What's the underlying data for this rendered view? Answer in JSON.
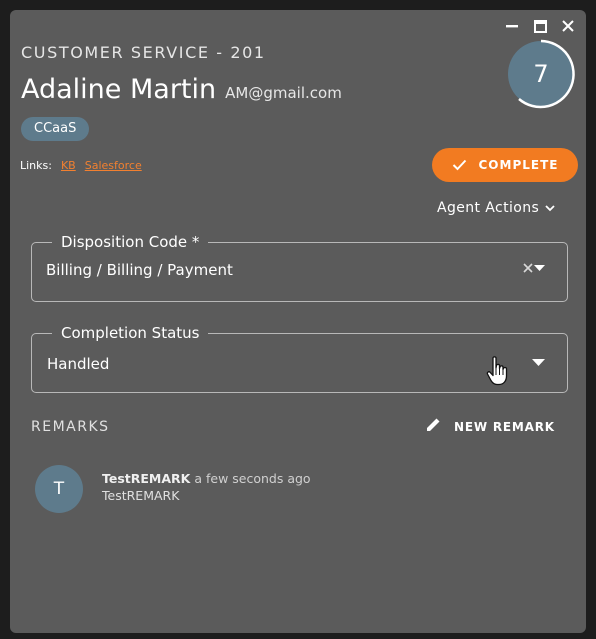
{
  "window": {
    "controls": [
      {
        "name": "minimize-icon"
      },
      {
        "name": "maximize-icon"
      },
      {
        "name": "close-icon"
      }
    ]
  },
  "header": {
    "queue": "CUSTOMER SERVICE - 201",
    "customer_name": "Adaline Martin",
    "customer_email": "AM@gmail.com",
    "chip": "CCaaS",
    "links_label": "Links:",
    "links": [
      "KB",
      "Salesforce"
    ],
    "timer_value": "7"
  },
  "actions": {
    "complete_label": "COMPLETE",
    "agent_actions_label": "Agent Actions"
  },
  "disposition": {
    "label": "Disposition Code *",
    "value": "Billing / Billing / Payment"
  },
  "completion": {
    "label": "Completion Status",
    "value": "Handled"
  },
  "remarks": {
    "title": "REMARKS",
    "new_label": "NEW REMARK",
    "items": [
      {
        "avatar": "T",
        "author": "TestREMARK",
        "time": "a few seconds ago",
        "text": "TestREMARK"
      }
    ]
  },
  "colors": {
    "panel": "#5b5b5b",
    "accent": "#f27b21",
    "chip": "#5e7b8c",
    "link": "#f28030"
  }
}
